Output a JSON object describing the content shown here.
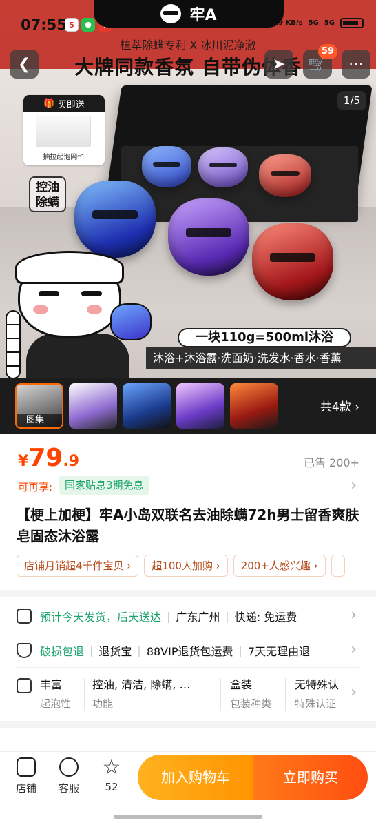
{
  "status_bar": {
    "time": "07:55",
    "net_speed": "30.9 KB/s",
    "signal_1": "5G",
    "signal_2": "5G",
    "notch_brand": "牢A"
  },
  "hero": {
    "headline_sub": "植萃除螨专利 X 冰川泥净澈",
    "headline": "大牌同款香氛 自带伪体香",
    "page_indicator": "1/5",
    "cart_count": "59",
    "gift_label": "买即送",
    "gift_caption": "抽拉起泡网*1",
    "oil_tag": [
      "控油",
      "除螨"
    ],
    "slogan": "一块110g=500ml沐浴",
    "uses": "沐浴+沐浴露·洗面奶·洗发水·香水·香薰"
  },
  "thumbs": {
    "gallery_label": "图集",
    "more_label": "共4款",
    "items": [
      "gallery",
      "box-white",
      "ocean",
      "galaxy",
      "lava"
    ]
  },
  "price": {
    "currency": "¥",
    "integer": "79",
    "decimal": ".9",
    "sold": "已售 200+",
    "enjoy_label": "可再享:",
    "subsidy": "国家贴息3期免息"
  },
  "title": "【梗上加梗】牢A小岛双联名去油除螨72h男士留香爽肤皂固态沐浴露",
  "chips": [
    "店铺月销超4千件宝贝 ›",
    "超100人加购 ›",
    "200+人感兴趣 ›"
  ],
  "service": {
    "shipping": "预计今天发货，后天送达",
    "origin": "广东广州",
    "express": "快递: 免运费",
    "guarantee": "破损包退",
    "return_1": "退货宝",
    "return_2": "88VIP退货包运费",
    "return_3": "7天无理由退"
  },
  "attributes": [
    {
      "value": "丰富",
      "key": "起泡性"
    },
    {
      "value": "控油, 清洁, 除螨, …",
      "key": "功能"
    },
    {
      "value": "盒装",
      "key": "包装种类"
    },
    {
      "value": "无特殊认",
      "key": "特殊认证"
    }
  ],
  "bottom_bar": {
    "shop": "店铺",
    "service": "客服",
    "favorites": "52",
    "add_cart": "加入购物车",
    "buy_now": "立即购买"
  },
  "colors": {
    "accent": "#ff4400",
    "green": "#1aa36a",
    "cart_button": "#ff9400",
    "buy_button": "#ff4d11"
  }
}
